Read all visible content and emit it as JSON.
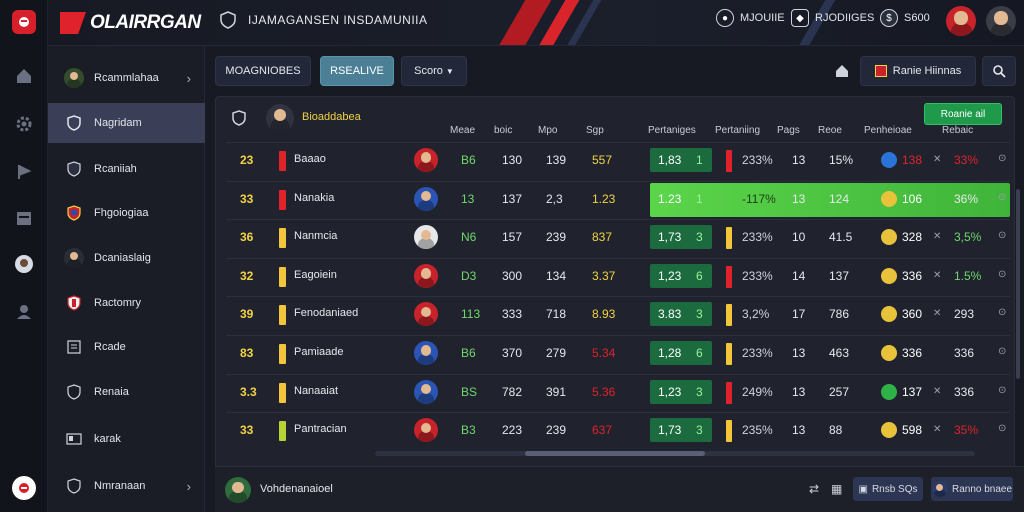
{
  "app": {
    "brand": "OLAIRRGAN",
    "title": "IJAMAGANSEN INSDAMUNIIA"
  },
  "header": {
    "user1_label": "MJOUIIE",
    "user2_label": "RJODIIGES",
    "user3_label": "S600"
  },
  "colors": {
    "accent_red": "#e0222a",
    "highlight_green": "#4cc944",
    "rank_yellow": "#f2d343"
  },
  "sidebar": {
    "items": [
      {
        "label": "Rcammlahaa",
        "icon": "avatar-icon"
      },
      {
        "label": "Nagridam",
        "icon": "shield-icon"
      },
      {
        "label": "Rcaniiah",
        "icon": "club-badge-icon"
      },
      {
        "label": "Fhgoiogiaa",
        "icon": "club-badge-icon"
      },
      {
        "label": "Dcaniaslaig",
        "icon": "avatar-icon"
      },
      {
        "label": "Ractomry",
        "icon": "club-badge-icon"
      },
      {
        "label": "Rcade",
        "icon": "document-icon"
      },
      {
        "label": "Renaia",
        "icon": "shield-icon"
      },
      {
        "label": "karak",
        "icon": "id-card-icon"
      },
      {
        "label": "Nmranaan",
        "icon": "shield-icon"
      }
    ]
  },
  "toolbar": {
    "tab1": "MOAGNIOBES",
    "tab2": "RSEALIVE",
    "tab3": "Scoro",
    "filter_label": "Ranie Hiinnas"
  },
  "panel": {
    "header_name": "Bioaddabea",
    "action_button": "Roanie ail"
  },
  "table": {
    "columns": [
      "Meae",
      "boic",
      "Mpo",
      "Sgp",
      "Pertaniges",
      "Pertaniing",
      "Pags",
      "Reoe",
      "Penheioae",
      "Rebaic"
    ],
    "rows": [
      {
        "rank": "23",
        "name": "Baaao",
        "c1": "B6",
        "c2": "130",
        "c3": "139",
        "c4": "557",
        "c4color": "#f2d343",
        "odds": "1,83",
        "odds2": "1",
        "pct": "233%",
        "p1": "13",
        "p2": "15%",
        "pen": "138",
        "rb": "33%",
        "bar": "#e0222a"
      },
      {
        "rank": "33",
        "name": "Nanakia",
        "c1": "13",
        "c2": "137",
        "c3": "2,3",
        "c4": "1.23",
        "c4color": "#f2d343",
        "odds": "1.23",
        "odds2": "1",
        "pct": "-117%",
        "p1": "13",
        "p2": "124",
        "pen": "106",
        "rb": "36%",
        "bar": "#e0222a"
      },
      {
        "rank": "36",
        "name": "Nanmcia",
        "c1": "N6",
        "c2": "157",
        "c3": "239",
        "c4": "837",
        "c4color": "#f2d343",
        "odds": "1,73",
        "odds2": "3",
        "pct": "233%",
        "p1": "10",
        "p2": "41.5",
        "pen": "328",
        "rb": "3,5%",
        "bar": "#f2c53a"
      },
      {
        "rank": "32",
        "name": "Eagoiein",
        "c1": "D3",
        "c2": "300",
        "c3": "134",
        "c4": "3.37",
        "c4color": "#f2d343",
        "odds": "1,23",
        "odds2": "6",
        "pct": "233%",
        "p1": "14",
        "p2": "137",
        "pen": "336",
        "rb": "1.5%",
        "bar": "#f2c53a"
      },
      {
        "rank": "39",
        "name": "Fenodaniaed",
        "c1": "113",
        "c2": "333",
        "c3": "718",
        "c4": "8.93",
        "c4color": "#f2d343",
        "odds": "3.83",
        "odds2": "3",
        "pct": "3,2%",
        "p1": "17",
        "p2": "786",
        "pen": "360",
        "rb": "293",
        "bar": "#f2c53a"
      },
      {
        "rank": "83",
        "name": "Pamiaade",
        "c1": "B6",
        "c2": "370",
        "c3": "279",
        "c4": "5.34",
        "c4color": "#e0222a",
        "odds": "1,28",
        "odds2": "6",
        "pct": "233%",
        "p1": "13",
        "p2": "463",
        "pen": "336",
        "rb": "336",
        "bar": "#f2c53a"
      },
      {
        "rank": "3.3",
        "name": "Nanaaiat",
        "c1": "BS",
        "c2": "782",
        "c3": "391",
        "c4": "5.36",
        "c4color": "#e0222a",
        "odds": "1,23",
        "odds2": "3",
        "pct": "249%",
        "p1": "13",
        "p2": "257",
        "pen": "137",
        "rb": "336",
        "bar": "#f2c53a"
      },
      {
        "rank": "33",
        "name": "Pantracian",
        "c1": "B3",
        "c2": "223",
        "c3": "239",
        "c4": "637",
        "c4color": "#e0222a",
        "odds": "1,73",
        "odds2": "3",
        "pct": "235%",
        "p1": "13",
        "p2": "88",
        "pen": "598",
        "rb": "35%",
        "bar": "#b8d236"
      }
    ]
  },
  "bottom": {
    "label": "Vohdenanaioel",
    "chip1": "Rnsb SQs",
    "chip2": "Ranno bnaee"
  }
}
